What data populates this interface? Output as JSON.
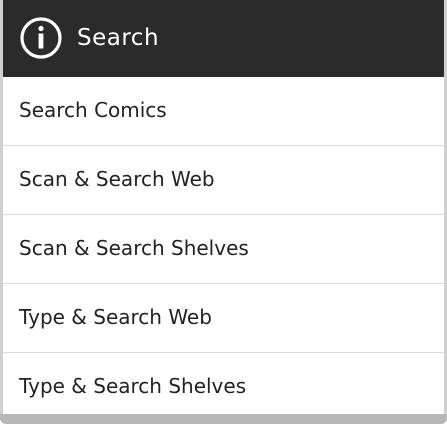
{
  "action_bar": {
    "title": "Search",
    "icon": "info-circle-icon",
    "background": "#2b2b2b"
  },
  "menu": {
    "items": [
      {
        "label": "Search Comics"
      },
      {
        "label": "Scan & Search Web"
      },
      {
        "label": "Scan & Search Shelves"
      },
      {
        "label": "Type & Search Web"
      },
      {
        "label": "Type & Search Shelves"
      }
    ]
  }
}
